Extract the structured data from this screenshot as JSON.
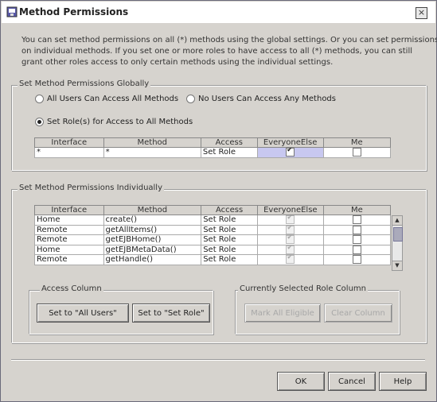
{
  "window": {
    "title": "Method Permissions",
    "close_glyph": "×"
  },
  "description": [
    "You can set method permissions on all (*) methods using the global settings. Or you can set permissions",
    "on individual methods. If you set one or more roles to have access to all (*) methods, you can still",
    "grant other roles access to only certain methods using the individual settings."
  ],
  "global": {
    "label": "Set Method Permissions Globally",
    "radio_all": "All Users Can Access All Methods",
    "radio_none": "No Users Can Access Any Methods",
    "radio_role": "Set Role(s) for Access to All Methods",
    "selected": "role",
    "columns": [
      "Interface",
      "Method",
      "Access",
      "EveryoneElse",
      "Me"
    ],
    "rows": [
      {
        "interface": "*",
        "method": "*",
        "access": "Set Role",
        "everyone_else": true,
        "me": false
      }
    ]
  },
  "individual": {
    "label": "Set Method Permissions Individually",
    "columns": [
      "Interface",
      "Method",
      "Access",
      "EveryoneElse",
      "Me"
    ],
    "rows": [
      {
        "interface": "Home",
        "method": "create()",
        "access": "Set Role",
        "everyone_else": true,
        "me": false
      },
      {
        "interface": "Remote",
        "method": "getAllItems()",
        "access": "Set Role",
        "everyone_else": true,
        "me": false
      },
      {
        "interface": "Remote",
        "method": "getEJBHome()",
        "access": "Set Role",
        "everyone_else": true,
        "me": false
      },
      {
        "interface": "Home",
        "method": "getEJBMetaData()",
        "access": "Set Role",
        "everyone_else": true,
        "me": false
      },
      {
        "interface": "Remote",
        "method": "getHandle()",
        "access": "Set Role",
        "everyone_else": true,
        "me": false
      }
    ],
    "access_column": {
      "label": "Access Column",
      "set_all_users": "Set to \"All Users\"",
      "set_role": "Set to \"Set Role\""
    },
    "role_column": {
      "label": "Currently Selected Role Column",
      "mark_all": "Mark All Eligible",
      "clear": "Clear Column"
    }
  },
  "footer": {
    "ok": "OK",
    "cancel": "Cancel",
    "help": "Help"
  }
}
